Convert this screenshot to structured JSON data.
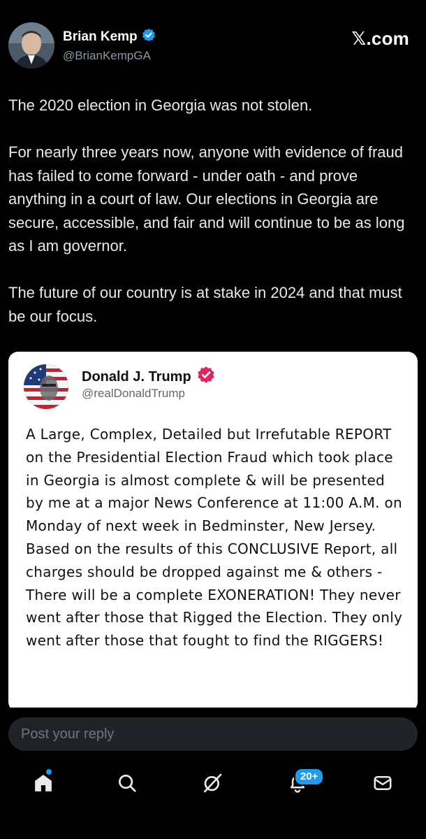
{
  "author": {
    "name": "Brian Kemp",
    "handle": "@BrianKempGA",
    "verified_icon": "verified-badge-icon",
    "site": "𝕏.com"
  },
  "tweet": {
    "paragraphs": [
      "The 2020 election in Georgia was not stolen.",
      "For nearly three years now, anyone with evidence of fraud has failed to come forward - under oath - and prove anything in a court of law. Our elections in Georgia are secure, accessible, and fair and will continue to be as long as I am governor.",
      "The future of our country is at stake in 2024 and that must be our focus."
    ]
  },
  "quote": {
    "name": "Donald J. Trump",
    "handle": "@realDonaldTrump",
    "verified_icon": "verified-badge-icon",
    "text": "A Large, Complex, Detailed but Irrefutable REPORT on the Presidential Election Fraud which took place in Georgia is almost complete & will be presented by me at a major News Conference at 11:00 A.M. on Monday of next week in Bedminster, New Jersey. Based on the results of this CONCLUSIVE Report, all charges should be dropped against me & others - There will be a complete EXONERATION! They never went after those that Rigged the Election. They only went after those that fought to find the RIGGERS!"
  },
  "reply": {
    "placeholder": "Post your reply"
  },
  "nav": {
    "items": [
      "home-icon",
      "search-icon",
      "grok-icon",
      "notifications-icon",
      "messages-icon"
    ],
    "notifications_badge": "20+"
  },
  "colors": {
    "accent": "#1d9bf0",
    "background": "#000000",
    "quote_verified": "#e0245e"
  }
}
